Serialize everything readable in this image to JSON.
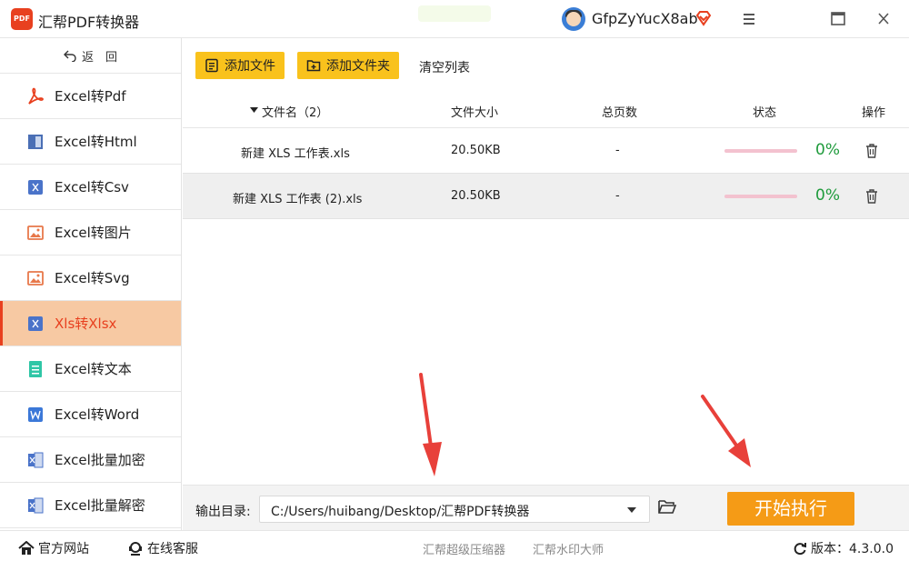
{
  "app": {
    "title": "汇帮PDF转换器",
    "logo_text": "PDF",
    "username": "GfpZyYucX8ab"
  },
  "sidebar": {
    "back_label": "返　回",
    "items": [
      {
        "label": "Excel转Pdf",
        "icon": "pdf-icon"
      },
      {
        "label": "Excel转Html",
        "icon": "html-icon"
      },
      {
        "label": "Excel转Csv",
        "icon": "excel-icon"
      },
      {
        "label": "Excel转图片",
        "icon": "image-icon"
      },
      {
        "label": "Excel转Svg",
        "icon": "image-icon"
      },
      {
        "label": "Xls转Xlsx",
        "icon": "excel-icon",
        "active": true
      },
      {
        "label": "Excel转文本",
        "icon": "text-file-icon"
      },
      {
        "label": "Excel转Word",
        "icon": "word-icon"
      },
      {
        "label": "Excel批量加密",
        "icon": "excel-lock-icon"
      },
      {
        "label": "Excel批量解密",
        "icon": "excel-unlock-icon"
      }
    ]
  },
  "toolbar": {
    "add_file": "添加文件",
    "add_folder": "添加文件夹",
    "clear_list": "清空列表"
  },
  "table": {
    "headers": {
      "name": "文件名（2）",
      "size": "文件大小",
      "pages": "总页数",
      "status": "状态",
      "action": "操作"
    },
    "rows": [
      {
        "name": "新建 XLS 工作表.xls",
        "size": "20.50KB",
        "pages": "-",
        "progress": "0%"
      },
      {
        "name": "新建 XLS 工作表 (2).xls",
        "size": "20.50KB",
        "pages": "-",
        "progress": "0%"
      }
    ]
  },
  "output": {
    "label": "输出目录:",
    "path": "C:/Users/huibang/Desktop/汇帮PDF转换器",
    "start_button": "开始执行"
  },
  "statusbar": {
    "website": "官方网站",
    "service": "在线客服",
    "compressor": "汇帮超级压缩器",
    "watermark": "汇帮水印大师",
    "version": "版本：4.3.0.0"
  },
  "colors": {
    "accent": "#e8401f",
    "toolbar_button": "#f9c21c",
    "start_button": "#f59b16",
    "active_item_bg": "#f7c9a3",
    "progress_text": "#1f9b3c"
  }
}
